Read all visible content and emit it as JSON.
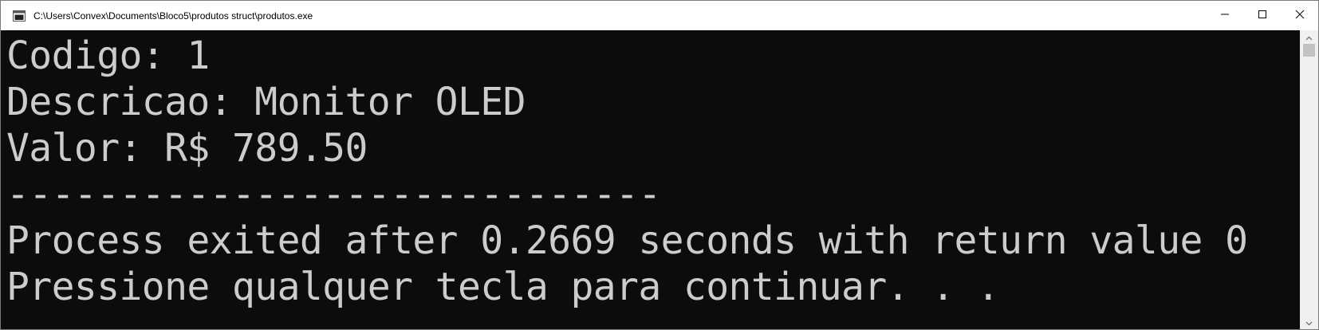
{
  "window": {
    "title": "C:\\Users\\Convex\\Documents\\Bloco5\\produtos struct\\produtos.exe"
  },
  "console": {
    "lines": [
      "Codigo: 1",
      "Descricao: Monitor OLED",
      "Valor: R$ 789.50",
      "-----------------------------",
      "Process exited after 0.2669 seconds with return value 0",
      "Pressione qualquer tecla para continuar. . ."
    ]
  },
  "icons": {
    "app": "console-window-icon",
    "minimize": "minimize-icon",
    "maximize": "maximize-icon",
    "close": "close-icon",
    "scroll_up": "chevron-up-icon",
    "scroll_down": "chevron-down-icon"
  },
  "colors": {
    "console_background": "#0c0c0c",
    "console_text": "#cccccc",
    "titlebar_background": "#ffffff"
  }
}
